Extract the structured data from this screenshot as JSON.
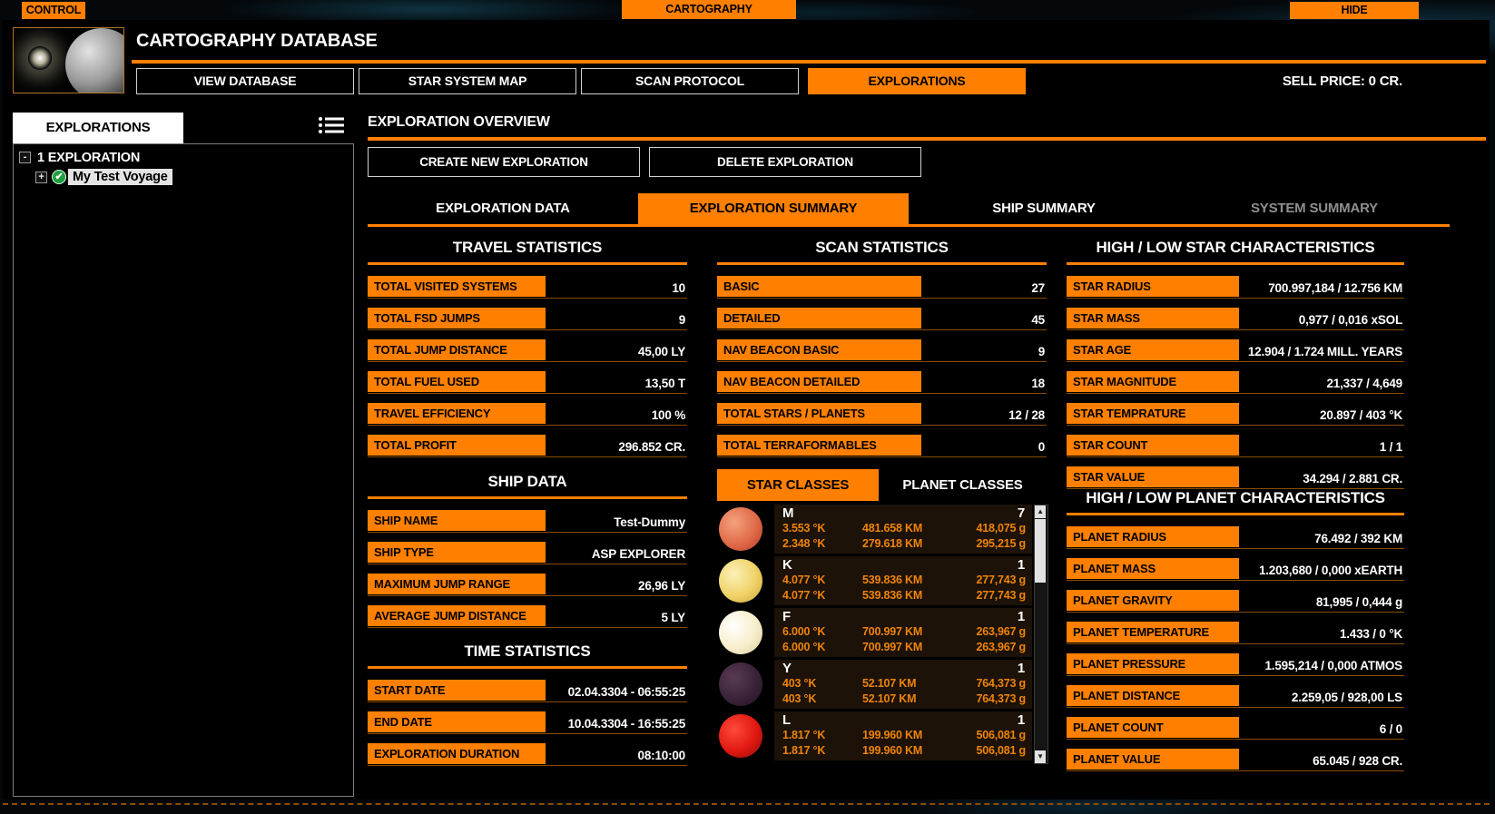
{
  "top_bar": {
    "control": "CONTROL",
    "cartography": "CARTOGRAPHY",
    "hide": "HIDE"
  },
  "header": {
    "title": "CARTOGRAPHY DATABASE",
    "sell_price": "SELL PRICE: 0 CR.",
    "nav": [
      {
        "label": "VIEW DATABASE",
        "active": false
      },
      {
        "label": "STAR SYSTEM MAP",
        "active": false
      },
      {
        "label": "SCAN PROTOCOL",
        "active": false
      },
      {
        "label": "EXPLORATIONS",
        "active": true
      }
    ]
  },
  "sidebar": {
    "tab_label": "EXPLORATIONS",
    "root_label": "1 EXPLORATION",
    "child_label": "My Test Voyage",
    "collapse_glyph": "-",
    "expand_glyph": "+",
    "check_glyph": "✔"
  },
  "overview": {
    "title": "EXPLORATION OVERVIEW",
    "create_button": "CREATE NEW EXPLORATION",
    "delete_button": "DELETE EXPLORATION",
    "tabs": [
      {
        "label": "EXPLORATION DATA",
        "state": "normal"
      },
      {
        "label": "EXPLORATION SUMMARY",
        "state": "active"
      },
      {
        "label": "SHIP SUMMARY",
        "state": "normal"
      },
      {
        "label": "SYSTEM SUMMARY",
        "state": "disabled"
      }
    ]
  },
  "sections": {
    "travel": {
      "title": "TRAVEL STATISTICS",
      "rows": [
        {
          "label": "TOTAL VISITED SYSTEMS",
          "value": "10"
        },
        {
          "label": "TOTAL FSD JUMPS",
          "value": "9"
        },
        {
          "label": "TOTAL JUMP DISTANCE",
          "value": "45,00 LY"
        },
        {
          "label": "TOTAL FUEL USED",
          "value": "13,50 T"
        },
        {
          "label": "TRAVEL EFFICIENCY",
          "value": "100 %"
        },
        {
          "label": "TOTAL PROFIT",
          "value": "296.852 CR."
        }
      ]
    },
    "ship": {
      "title": "SHIP DATA",
      "rows": [
        {
          "label": "SHIP NAME",
          "value": "Test-Dummy"
        },
        {
          "label": "SHIP TYPE",
          "value": "ASP EXPLORER"
        },
        {
          "label": "MAXIMUM JUMP RANGE",
          "value": "26,96 LY"
        },
        {
          "label": "AVERAGE JUMP DISTANCE",
          "value": "5 LY"
        }
      ]
    },
    "time": {
      "title": "TIME STATISTICS",
      "rows": [
        {
          "label": "START DATE",
          "value": "02.04.3304 - 06:55:25"
        },
        {
          "label": "END DATE",
          "value": "10.04.3304 - 16:55:25"
        },
        {
          "label": "EXPLORATION DURATION",
          "value": "08:10:00"
        }
      ]
    },
    "scan": {
      "title": "SCAN STATISTICS",
      "rows": [
        {
          "label": "BASIC",
          "value": "27"
        },
        {
          "label": "DETAILED",
          "value": "45"
        },
        {
          "label": "NAV BEACON BASIC",
          "value": "9"
        },
        {
          "label": "NAV BEACON DETAILED",
          "value": "18"
        },
        {
          "label": "TOTAL STARS / PLANETS",
          "value": "12 / 28"
        },
        {
          "label": "TOTAL TERRAFORMABLES",
          "value": "0"
        }
      ]
    },
    "star_hl": {
      "title": "HIGH / LOW STAR CHARACTERISTICS",
      "rows": [
        {
          "label": "STAR RADIUS",
          "value": "700.997,184 / 12.756 KM"
        },
        {
          "label": "STAR MASS",
          "value": "0,977 / 0,016 xSOL"
        },
        {
          "label": "STAR AGE",
          "value": "12.904 / 1.724 MILL. YEARS"
        },
        {
          "label": "STAR MAGNITUDE",
          "value": "21,337 / 4,649"
        },
        {
          "label": "STAR TEMPRATURE",
          "value": "20.897 / 403 °K"
        },
        {
          "label": "STAR COUNT",
          "value": "1 / 1"
        },
        {
          "label": "STAR VALUE",
          "value": "34.294 / 2.881 CR."
        }
      ]
    },
    "planet_hl": {
      "title": "HIGH / LOW PLANET CHARACTERISTICS",
      "rows": [
        {
          "label": "PLANET RADIUS",
          "value": "76.492 / 392 KM"
        },
        {
          "label": "PLANET MASS",
          "value": "1.203,680 / 0,000 xEARTH"
        },
        {
          "label": "PLANET GRAVITY",
          "value": "81,995 / 0,444 g"
        },
        {
          "label": "PLANET TEMPERATURE",
          "value": "1.433 / 0 °K"
        },
        {
          "label": "PLANET PRESSURE",
          "value": "1.595,214 / 0,000 ATMOS"
        },
        {
          "label": "PLANET DISTANCE",
          "value": "2.259,05 / 928,00 LS"
        },
        {
          "label": "PLANET COUNT",
          "value": "6 / 0"
        },
        {
          "label": "PLANET VALUE",
          "value": "65.045 / 928 CR."
        }
      ]
    }
  },
  "classes": {
    "tabs": [
      {
        "label": "STAR CLASSES",
        "active": true
      },
      {
        "label": "PLANET CLASSES",
        "active": false
      }
    ],
    "star_classes": [
      {
        "class": "M",
        "count": "7",
        "high": [
          "3.553 °K",
          "481.658 KM",
          "418,075 g"
        ],
        "low": [
          "2.348 °K",
          "279.618 KM",
          "295,215 g"
        ],
        "sphere": [
          "#f5a27d",
          "#e06a48",
          "#b23c26"
        ]
      },
      {
        "class": "K",
        "count": "1",
        "high": [
          "4.077 °K",
          "539.836 KM",
          "277,743 g"
        ],
        "low": [
          "4.077 °K",
          "539.836 KM",
          "277,743 g"
        ],
        "sphere": [
          "#faf0b8",
          "#f0d268",
          "#c9a43a"
        ]
      },
      {
        "class": "F",
        "count": "1",
        "high": [
          "6.000 °K",
          "700.997 KM",
          "263,967 g"
        ],
        "low": [
          "6.000 °K",
          "700.997 KM",
          "263,967 g"
        ],
        "sphere": [
          "#ffffff",
          "#f7eecb",
          "#d8cb9a"
        ]
      },
      {
        "class": "Y",
        "count": "1",
        "high": [
          "403 °K",
          "52.107 KM",
          "764,373 g"
        ],
        "low": [
          "403 °K",
          "52.107 KM",
          "764,373 g"
        ],
        "sphere": [
          "#5a3a56",
          "#3a2338",
          "#221222"
        ]
      },
      {
        "class": "L",
        "count": "1",
        "high": [
          "1.817 °K",
          "199.960 KM",
          "506,081 g"
        ],
        "low": [
          "1.817 °K",
          "199.960 KM",
          "506,081 g"
        ],
        "sphere": [
          "#ff4a38",
          "#e01812",
          "#8e0b08"
        ]
      }
    ],
    "scroll_up_glyph": "▲",
    "scroll_down_glyph": "▼"
  },
  "colors": {
    "accent": "#ff8000",
    "row_line": "#8a4c00",
    "list_row_bg": "#1c1208",
    "selection_bg": "#e4e4e4"
  }
}
